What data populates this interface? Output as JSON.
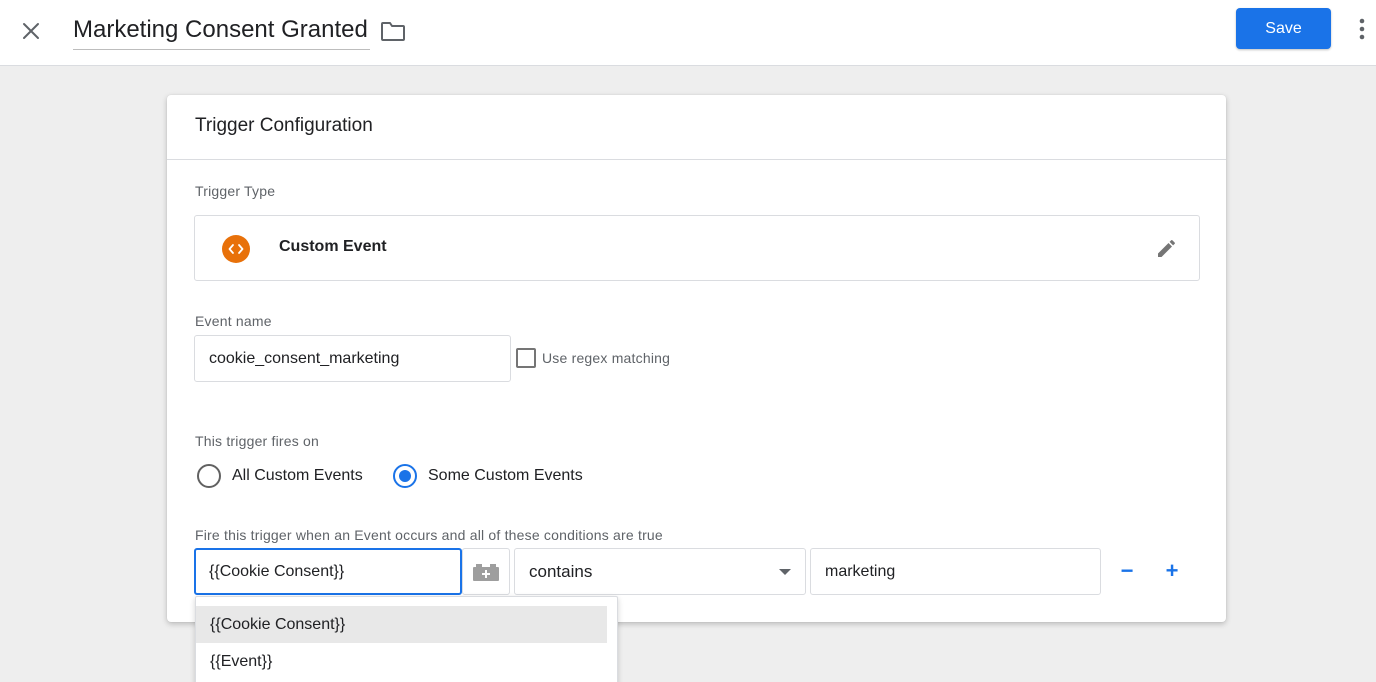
{
  "header": {
    "title": "Marketing Consent Granted",
    "save_label": "Save"
  },
  "card": {
    "title": "Trigger Configuration",
    "trigger_type_label": "Trigger Type",
    "trigger_type_name": "Custom Event",
    "event_name_label": "Event name",
    "event_name_value": "cookie_consent_marketing",
    "regex_label": "Use regex matching",
    "regex_checked": false,
    "fires_on_label": "This trigger fires on",
    "fires_on_options": [
      {
        "label": "All Custom Events",
        "selected": false
      },
      {
        "label": "Some Custom Events",
        "selected": true
      }
    ],
    "condition_label": "Fire this trigger when an Event occurs and all of these conditions are true",
    "condition": {
      "variable": "{{Cookie Consent}}",
      "operator": "contains",
      "value": "marketing"
    },
    "remove_label": "−",
    "add_label": "+"
  },
  "dropdown": {
    "items": [
      "{{Cookie Consent}}",
      "{{Event}}"
    ]
  },
  "colors": {
    "accent": "#1a73e8",
    "trigger_icon": "#e8710a"
  }
}
